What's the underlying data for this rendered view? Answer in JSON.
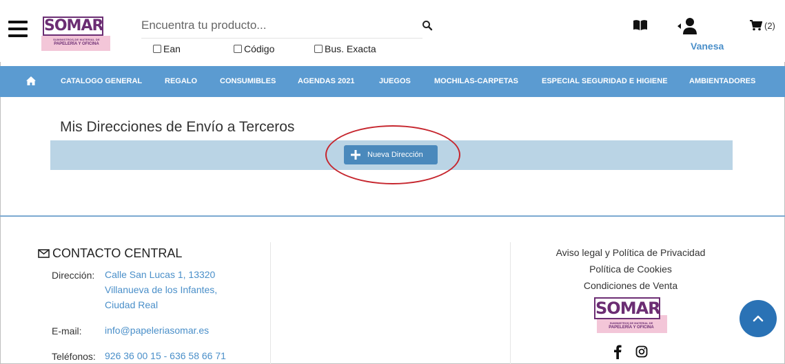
{
  "header": {
    "search_placeholder": "Encuentra tu producto...",
    "checkboxes": [
      "Ean",
      "Código",
      "Bus. Exacta"
    ],
    "user_name": "Vanesa",
    "cart_count": "(2)"
  },
  "logo": {
    "word": "SOMAR",
    "sub1": "SUMINISTROS DE MATERIAL DE",
    "sub2": "PAPELERÍA Y OFICINA"
  },
  "nav": {
    "items": [
      "CATALOGO GENERAL",
      "REGALO",
      "CONSUMIBLES",
      "AGENDAS 2021",
      "JUEGOS",
      "MOCHILAS-CARPETAS",
      "ESPECIAL SEGURIDAD E HIGIENE",
      "AMBIENTADORES"
    ]
  },
  "main": {
    "title": "Mis Direcciones de Envío a Terceros",
    "new_address_button": "Nueva Dirección"
  },
  "footer": {
    "contact_title": "CONTACTO CENTRAL",
    "address_label": "Dirección:",
    "address_lines": [
      "Calle San Lucas 1, 13320",
      "Villanueva de los Infantes,",
      "Ciudad Real"
    ],
    "email_label": "E-mail:",
    "email": "info@papeleriasomar.es",
    "phones_label": "Teléfonos:",
    "phones": "926 36 00 15 - 636 58 66 71",
    "links": [
      "Aviso legal y Política de Privacidad",
      "Política de Cookies",
      "Condiciones de Venta"
    ]
  },
  "colors": {
    "nav_bg": "#5b9bd1",
    "bar_bg": "#bad4e5",
    "button_bg": "#4a89bc",
    "link": "#4a8fc9",
    "brand_purple": "#6b2d73",
    "highlight_circle": "#c6262e",
    "scroll_top_btn": "#2a72b5"
  },
  "icons": [
    "menu-icon",
    "search-icon",
    "book-icon",
    "user-icon",
    "cart-icon",
    "home-icon",
    "plus-icon",
    "envelope-icon",
    "facebook-icon",
    "instagram-icon",
    "chevron-up-icon"
  ]
}
